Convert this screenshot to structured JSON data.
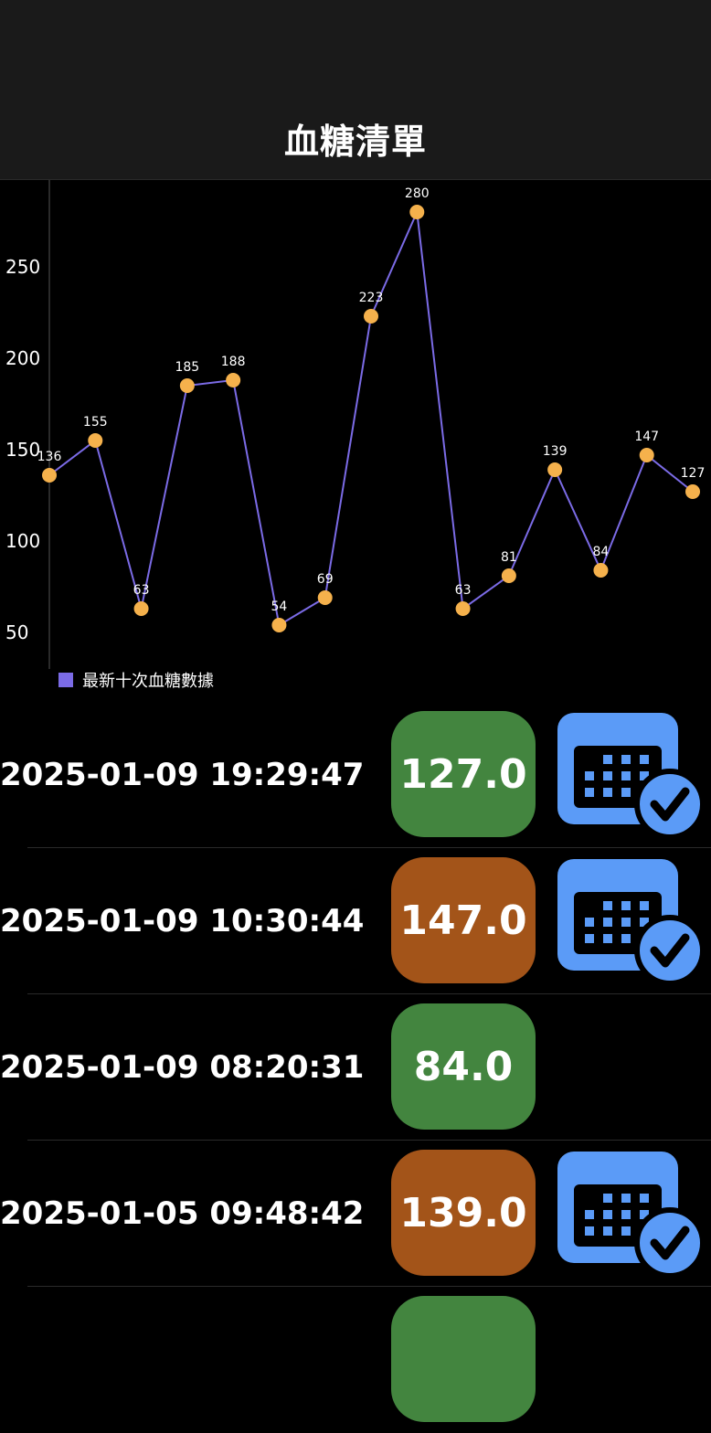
{
  "header": {
    "title": "血糖清單"
  },
  "chart_data": {
    "type": "line",
    "x": [
      1,
      2,
      3,
      4,
      5,
      6,
      7,
      8,
      9,
      10,
      11,
      12,
      13,
      14,
      15
    ],
    "series": [
      {
        "name": "最新十次血糖數據",
        "values": [
          136,
          155,
          63,
          185,
          188,
          54,
          69,
          223,
          280,
          63,
          81,
          139,
          84,
          147,
          127
        ]
      }
    ],
    "y_ticks": [
      50,
      100,
      150,
      200,
      250
    ],
    "ylim": [
      37,
      291
    ],
    "line_color": "#7b6be6",
    "point_color": "#f5b14c",
    "legend_position": "bottom-left",
    "grid": false
  },
  "records": [
    {
      "timestamp": "2025-01-09 19:29:47",
      "value": "127.0",
      "color": "#43853f",
      "calendar": true
    },
    {
      "timestamp": "2025-01-09 10:30:44",
      "value": "147.0",
      "color": "#a35419",
      "calendar": true
    },
    {
      "timestamp": "2025-01-09 08:20:31",
      "value": "84.0",
      "color": "#43853f",
      "calendar": false
    },
    {
      "timestamp": "2025-01-05 09:48:42",
      "value": "139.0",
      "color": "#a35419",
      "calendar": true
    },
    {
      "timestamp": "",
      "value": "",
      "color": "#43853f",
      "calendar": false
    }
  ],
  "icons": {
    "calendar": "calendar-check-icon"
  },
  "colors": {
    "calendar_blue": "#5b9bf7"
  }
}
